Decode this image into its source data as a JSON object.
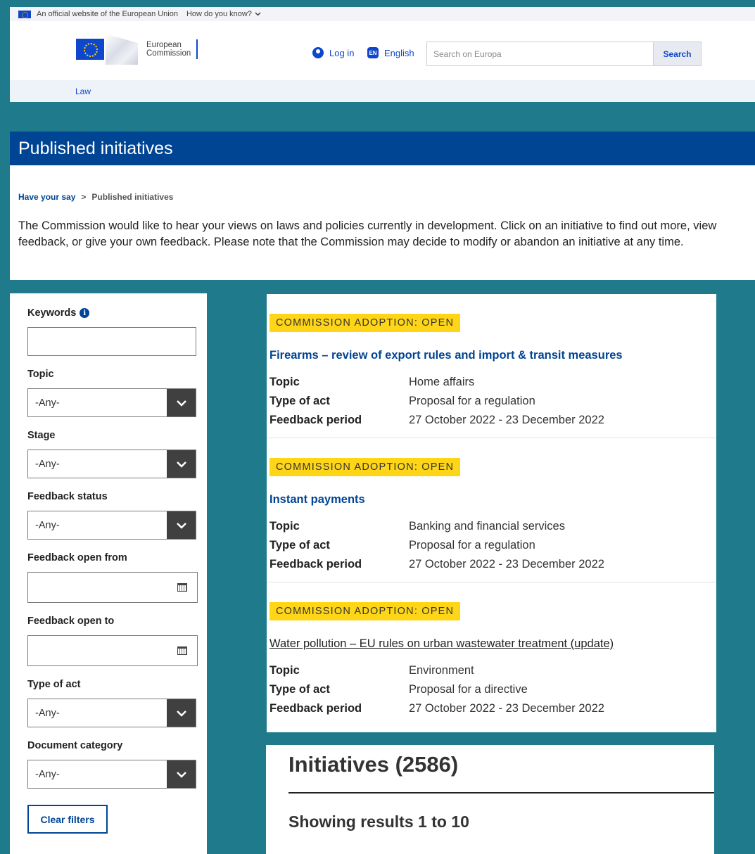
{
  "official_bar": {
    "text": "An official website of the European Union",
    "how": "How do you know?"
  },
  "header": {
    "logo_line1": "European",
    "logo_line2": "Commission",
    "login": "Log in",
    "lang_code": "EN",
    "lang": "English",
    "search_placeholder": "Search on Europa",
    "search_button": "Search"
  },
  "site_nav": {
    "item": "Law"
  },
  "page": {
    "title": "Published initiatives",
    "breadcrumb_home": "Have your say",
    "breadcrumb_sep": ">",
    "breadcrumb_current": "Published initiatives",
    "intro": "The Commission would like to hear your views on laws and policies currently in development. Click on an initiative to find out more, view feedback, or give your own feedback. Please note that the Commission may decide to modify or abandon an initiative at any time."
  },
  "filters": {
    "keywords_label": "Keywords",
    "topic_label": "Topic",
    "topic_value": "-Any-",
    "stage_label": "Stage",
    "stage_value": "-Any-",
    "feedback_status_label": "Feedback status",
    "feedback_status_value": "-Any-",
    "open_from_label": "Feedback open from",
    "open_to_label": "Feedback open to",
    "type_label": "Type of act",
    "type_value": "-Any-",
    "category_label": "Document category",
    "category_value": "-Any-",
    "clear_button": "Clear filters"
  },
  "results": {
    "labels": {
      "topic": "Topic",
      "type": "Type of act",
      "period": "Feedback period"
    },
    "items": [
      {
        "badge": "COMMISSION ADOPTION: OPEN",
        "title": "Firearms – review of export rules and import & transit measures",
        "topic": "Home affairs",
        "type": "Proposal for a regulation",
        "period": "27 October 2022 - 23 December 2022"
      },
      {
        "badge": "COMMISSION ADOPTION: OPEN",
        "title": "Instant payments",
        "topic": "Banking and financial services",
        "type": "Proposal for a regulation",
        "period": "27 October 2022 - 23 December 2022"
      },
      {
        "badge": "COMMISSION ADOPTION: OPEN",
        "title": "Water pollution – EU rules on urban wastewater treatment (update)",
        "topic": "Environment",
        "type": "Proposal for a directive",
        "period": "27 October 2022 - 23 December 2022"
      }
    ]
  },
  "counts": {
    "title": "Initiatives (2586)",
    "showing": "Showing results 1 to 10"
  }
}
